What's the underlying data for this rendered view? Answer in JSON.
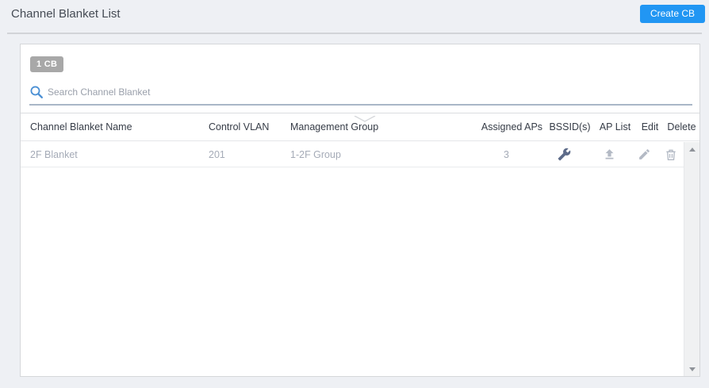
{
  "page": {
    "title": "Channel Blanket List"
  },
  "toolbar": {
    "create_cb_label": "Create CB"
  },
  "panel": {
    "count_badge": "1 CB",
    "search": {
      "placeholder": "Search Channel Blanket"
    }
  },
  "table": {
    "columns": [
      "Channel Blanket Name",
      "Control VLAN",
      "Management Group",
      "Assigned APs",
      "BSSID(s)",
      "AP List",
      "Edit",
      "Delete"
    ],
    "rows": [
      {
        "name": "2F Blanket",
        "control_vlan": "201",
        "management_group": "1-2F Group",
        "assigned_aps": "3",
        "bssid_icon": "wrench-icon",
        "ap_list_icon": "upload-icon",
        "edit_icon": "pencil-icon",
        "delete_icon": "trash-icon"
      }
    ]
  },
  "colors": {
    "accent_blue": "#2196f3",
    "search_icon_blue": "#4a8fd4",
    "wrench_icon_blue": "#5d6b89",
    "icon_gray": "#b4bac5",
    "badge_gray": "#a8a8a8"
  }
}
